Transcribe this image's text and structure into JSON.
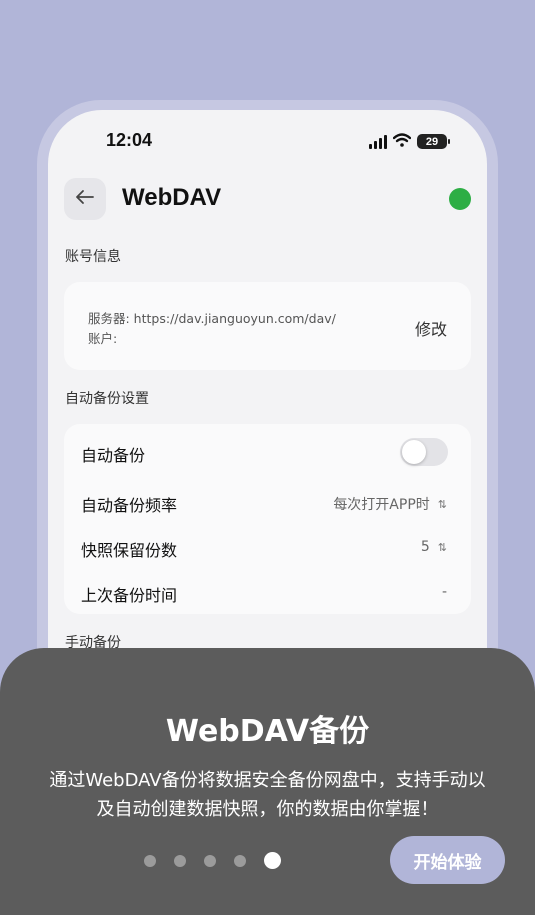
{
  "status_bar": {
    "time": "12:04",
    "battery": "29"
  },
  "nav": {
    "title": "WebDAV"
  },
  "account_section": {
    "label": "账号信息",
    "server_line": "服务器: https://dav.jianguoyun.com/dav/",
    "account_line": "账户:",
    "edit_label": "修改"
  },
  "auto_backup_section": {
    "label": "自动备份设置",
    "rows": [
      {
        "label": "自动备份",
        "toggle_on": false
      },
      {
        "label": "自动备份频率",
        "value": "每次打开APP时"
      },
      {
        "label": "快照保留份数",
        "value": "5"
      },
      {
        "label": "上次备份时间",
        "value": "-"
      }
    ]
  },
  "manual_section": {
    "label": "手动备份"
  },
  "sheet": {
    "title": "WebDAV备份",
    "description_line1": "通过WebDAV备份将数据安全备份网盘中，支持手动以",
    "description_line2": "及自动创建数据快照，你的数据由你掌握！",
    "page_count": 5,
    "active_page": 5,
    "start_button_label": "开始体验"
  },
  "colors": {
    "background": "#b1b5d8",
    "status_dot": "#2dae45",
    "sheet": "#5c5c5c",
    "accent_button": "#b1b5d8"
  }
}
